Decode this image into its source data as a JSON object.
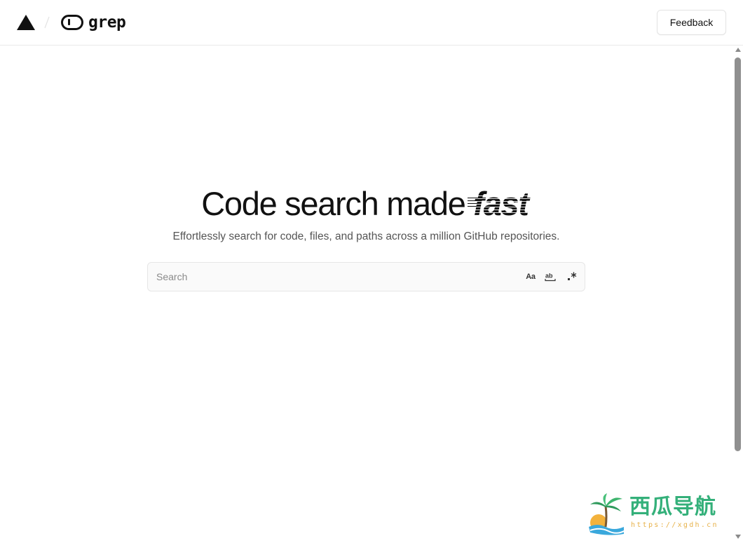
{
  "header": {
    "product_name": "grep",
    "feedback_label": "Feedback"
  },
  "hero": {
    "title_plain": "Code search made ",
    "title_emphasis": "fast",
    "subtitle": "Effortlessly search for code, files, and paths across a million GitHub repositories."
  },
  "search": {
    "placeholder": "Search",
    "value": "",
    "options": {
      "match_case": "Aa",
      "match_whole_words": "ab",
      "use_regex": ".*"
    }
  },
  "watermark": {
    "title": "西瓜导航",
    "url": "https://xgdh.cn"
  },
  "colors": {
    "text": "#171717",
    "muted": "#555555",
    "border": "#e6e6e6",
    "watermark_green": "#34b07a",
    "watermark_orange": "#e7b24a"
  }
}
